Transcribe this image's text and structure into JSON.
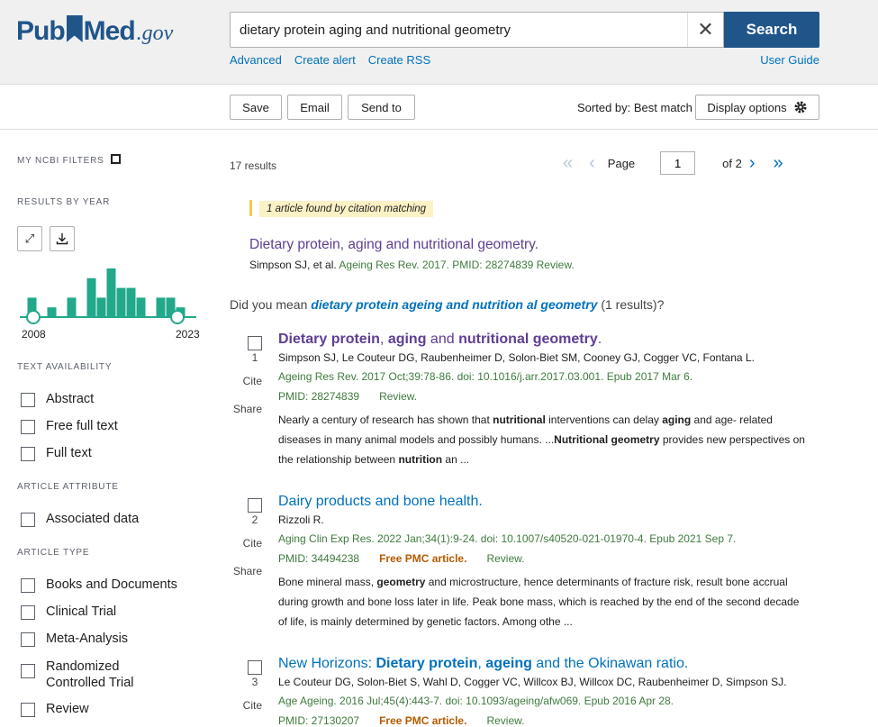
{
  "header": {
    "logo_pub": "Pub",
    "logo_med": "Med",
    "logo_gov": ".gov",
    "search_value": "dietary protein aging and nutritional geometry",
    "search_button": "Search",
    "clear_symbol": "✕",
    "links": [
      "Advanced",
      "Create alert",
      "Create RSS"
    ],
    "user_guide": "User Guide"
  },
  "toolbar": {
    "save": "Save",
    "email": "Email",
    "send_to": "Send to",
    "sorted_by": "Sorted by: Best match",
    "display_options": "Display options"
  },
  "sidebar": {
    "my_ncbi_filters": "MY NCBI FILTERS",
    "results_by_year": "RESULTS BY YEAR",
    "year_start": "2008",
    "year_end": "2023",
    "histogram_counts": [
      2,
      0,
      1,
      0,
      2,
      0,
      4,
      2,
      5,
      3,
      3,
      2,
      0,
      2,
      2,
      1
    ],
    "text_availability": "TEXT AVAILABILITY",
    "text_options": [
      "Abstract",
      "Free full text",
      "Full text"
    ],
    "article_attribute": "ARTICLE ATTRIBUTE",
    "attribute_options": [
      "Associated data"
    ],
    "article_type": "ARTICLE TYPE",
    "type_options": [
      "Books and Documents",
      "Clinical Trial",
      "Meta-Analysis",
      "Randomized Controlled Trial",
      "Review"
    ]
  },
  "results": {
    "count": "17 results",
    "page_label": "Page",
    "page_value": "1",
    "of_pages": "of 2",
    "citation_badge": "1 article found by citation matching",
    "citation_title": "Dietary protein, aging and nutritional geometry.",
    "citation_authors": "Simpson SJ, et al.",
    "citation_journal": "Ageing Res Rev. 2017. PMID: 28274839 Review.",
    "did_you_mean_prefix": "Did you mean",
    "did_you_mean_query": "dietary protein ageing and nutrition al geometry",
    "did_you_mean_suffix": "(1 results)?",
    "cite_label": "Cite",
    "share_label": "Share"
  },
  "articles": [
    {
      "num": "1",
      "title_parts": [
        [
          "Dietary protein",
          true
        ],
        [
          ", ",
          false
        ],
        [
          "aging",
          true
        ],
        [
          " and ",
          false
        ],
        [
          "nutritional geometry",
          true
        ],
        [
          ".",
          false
        ]
      ],
      "authors": "Simpson SJ, Le Couteur DG, Raubenheimer D, Solon-Biet SM, Cooney GJ, Cogger VC, Fontana L.",
      "journal": "Ageing Res Rev. 2017 Oct;39:78-86. doi: 10.1016/j.arr.2017.03.001. Epub 2017 Mar 6.",
      "pmid": "PMID: 28274839",
      "free": "",
      "type": "Review.",
      "snippet_parts": [
        [
          "Nearly a century of research has shown that ",
          false
        ],
        [
          "nutritional",
          true
        ],
        [
          " interventions can delay ",
          false
        ],
        [
          "aging",
          true
        ],
        [
          " and age- related diseases in many animal models and possibly humans. ...",
          false
        ],
        [
          "Nutritional geometry",
          true
        ],
        [
          " provides new perspectives on the relationship between ",
          false
        ],
        [
          "nutrition",
          true
        ],
        [
          " an ...",
          false
        ]
      ]
    },
    {
      "num": "2",
      "title_parts": [
        [
          "Dairy products and bone health.",
          false
        ]
      ],
      "authors": "Rizzoli R.",
      "journal": "Aging Clin Exp Res. 2022 Jan;34(1):9-24. doi: 10.1007/s40520-021-01970-4. Epub 2021 Sep 7.",
      "pmid": "PMID: 34494238",
      "free": "Free PMC article.",
      "type": "Review.",
      "snippet_parts": [
        [
          "Bone mineral mass, ",
          false
        ],
        [
          "geometry",
          true
        ],
        [
          " and microstructure, hence determinants of fracture risk, result bone accrual during growth and bone loss later in life. Peak bone mass, which is reached by the end of the second decade of life, is mainly determined by genetic factors. Among othe ...",
          false
        ]
      ]
    },
    {
      "num": "3",
      "title_parts": [
        [
          "New Horizons: ",
          false
        ],
        [
          "Dietary protein",
          true
        ],
        [
          ", ",
          false
        ],
        [
          "ageing",
          true
        ],
        [
          " and the Okinawan ratio.",
          false
        ]
      ],
      "authors": "Le Couteur DG, Solon-Biet S, Wahl D, Cogger VC, Willcox BJ, Willcox DC, Raubenheimer D, Simpson SJ.",
      "journal": "Age Ageing. 2016 Jul;45(4):443-7. doi: 10.1093/ageing/afw069. Epub 2016 Apr 28.",
      "pmid": "PMID: 27130207",
      "free": "Free PMC article.",
      "type": "Review.",
      "snippet_parts": []
    }
  ]
}
